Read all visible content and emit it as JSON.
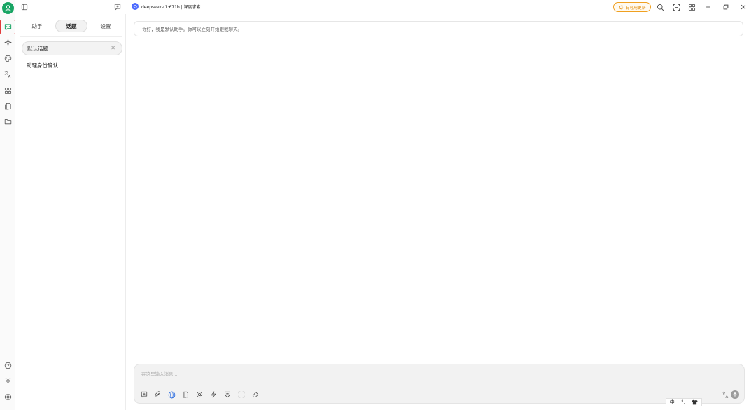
{
  "rail": {
    "items": [
      "chat-icon",
      "sparkle-icon",
      "palette-icon",
      "translate-icon",
      "apps-icon",
      "files-icon",
      "folder-icon"
    ],
    "bottom": [
      "help-icon",
      "theme-icon",
      "settings-icon"
    ]
  },
  "sidebar": {
    "tabs": [
      {
        "label": "助手"
      },
      {
        "label": "话题"
      },
      {
        "label": "设置"
      }
    ],
    "active_tab": "话题",
    "topics": [
      {
        "label": "默认话题",
        "active": true
      },
      {
        "label": "助理身份确认",
        "active": false
      }
    ]
  },
  "header": {
    "model": "deepseek-r1:671b | 深度求索",
    "update_label": "有可用更新"
  },
  "chat": {
    "greeting": "你好，我是默认助手。你可以立刻开始跟我聊天。"
  },
  "composer": {
    "placeholder": "在这里输入消息...",
    "tools": [
      "new-topic-icon",
      "attach-icon",
      "web-search-icon",
      "file-icon",
      "mention-icon",
      "quick-phrase-icon",
      "knowledge-icon",
      "expand-icon",
      "clear-icon"
    ]
  },
  "ime": {
    "lang": "中",
    "punct": "°,",
    "skin": "shirt-icon"
  },
  "colors": {
    "accent": "#17a463",
    "update": "#e08800",
    "model": "#4d6bfe",
    "active_outline": "#e23b3b"
  }
}
